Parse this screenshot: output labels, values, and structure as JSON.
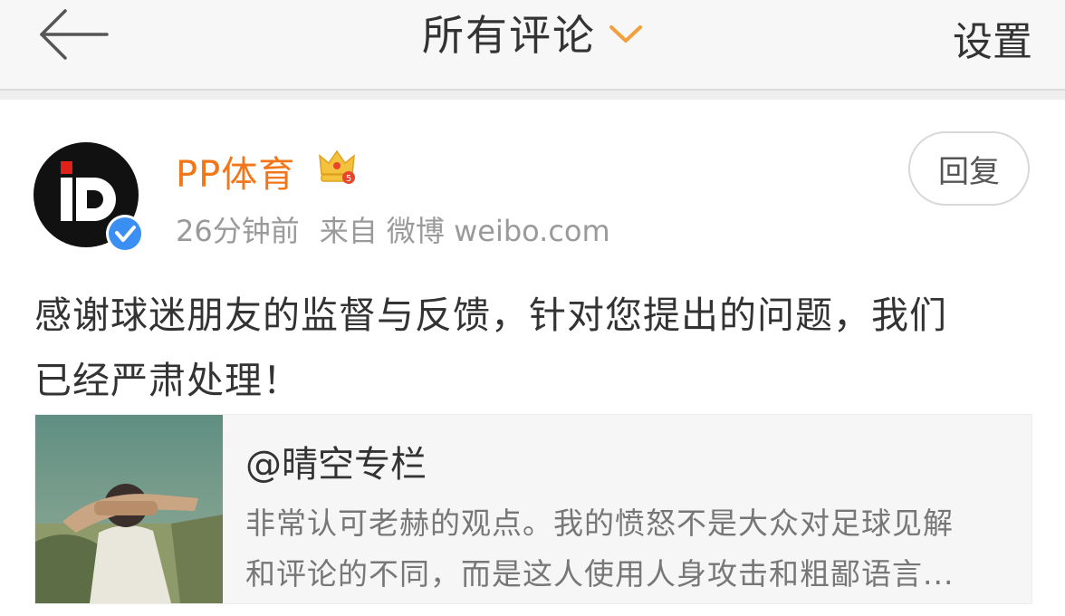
{
  "header": {
    "title": "所有评论",
    "settings_label": "设置",
    "back_icon": "back-arrow-icon",
    "dropdown_icon": "chevron-down-icon",
    "accent_color": "#f2a03d"
  },
  "post": {
    "author": "PP体育",
    "time": "26分钟前",
    "source": "来自 微博 weibo.com",
    "reply_label": "回复",
    "text_line1": "感谢球迷朋友的监督与反馈，针对您提出的问题，我们",
    "text_line2": "已经严肃处理！",
    "username_color": "#f2771a",
    "verified_icon": "verified-badge-icon",
    "member_icon": "crown-member-icon"
  },
  "quote": {
    "author": "@晴空专栏",
    "text_line1": "非常认可老赫的观点。我的愤怒不是大众对足球见解",
    "text_line2": "和评论的不同，而是这人使用人身攻击和粗鄙语言..."
  }
}
